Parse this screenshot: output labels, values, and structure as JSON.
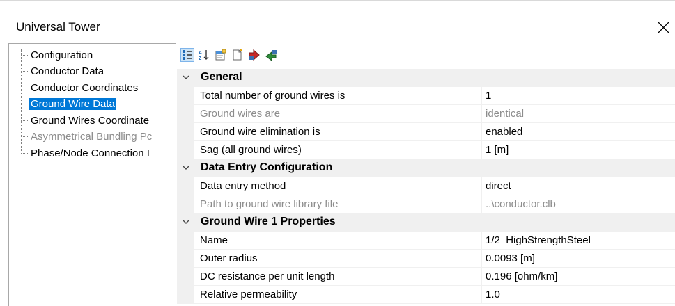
{
  "window": {
    "title": "Universal Tower"
  },
  "tree": {
    "items": [
      {
        "label": "Configuration",
        "state": "normal"
      },
      {
        "label": "Conductor Data",
        "state": "normal"
      },
      {
        "label": "Conductor Coordinates",
        "state": "normal"
      },
      {
        "label": "Ground Wire Data",
        "state": "selected"
      },
      {
        "label": "Ground Wires Coordinate",
        "state": "normal"
      },
      {
        "label": "Asymmetrical Bundling Pc",
        "state": "disabled"
      },
      {
        "label": "Phase/Node Connection I",
        "state": "normal"
      }
    ]
  },
  "toolbar": {
    "buttons": [
      {
        "icon": "categorized-icon",
        "active": true
      },
      {
        "icon": "sort-alphabetical-icon",
        "active": false
      },
      {
        "icon": "property-pages-icon",
        "active": false
      },
      {
        "icon": "new-document-icon",
        "active": false
      },
      {
        "icon": "import-icon",
        "active": false
      },
      {
        "icon": "export-icon",
        "active": false
      }
    ]
  },
  "categories": [
    {
      "label": "General",
      "properties": [
        {
          "name": "Total number of ground wires is",
          "value": "1",
          "disabled": false
        },
        {
          "name": "Ground wires are",
          "value": "identical",
          "disabled": true
        },
        {
          "name": "Ground wire elimination is",
          "value": "enabled",
          "disabled": false
        },
        {
          "name": "Sag (all ground wires)",
          "value": "1 [m]",
          "disabled": false
        }
      ]
    },
    {
      "label": "Data Entry Configuration",
      "properties": [
        {
          "name": "Data entry method",
          "value": "direct",
          "disabled": false
        },
        {
          "name": "Path to ground wire library file",
          "value": "..\\conductor.clb",
          "disabled": true
        }
      ]
    },
    {
      "label": "Ground Wire 1 Properties",
      "properties": [
        {
          "name": "Name",
          "value": "1/2_HighStrengthSteel",
          "disabled": false
        },
        {
          "name": "Outer radius",
          "value": "0.0093 [m]",
          "disabled": false
        },
        {
          "name": "DC resistance per unit length",
          "value": "0.196 [ohm/km]",
          "disabled": false
        },
        {
          "name": "Relative permeability",
          "value": "1.0",
          "disabled": false
        }
      ]
    }
  ],
  "colors": {
    "selection": "#0078d7",
    "disabled_text": "#8c8c8c",
    "gutter": "#f0f0f0"
  }
}
